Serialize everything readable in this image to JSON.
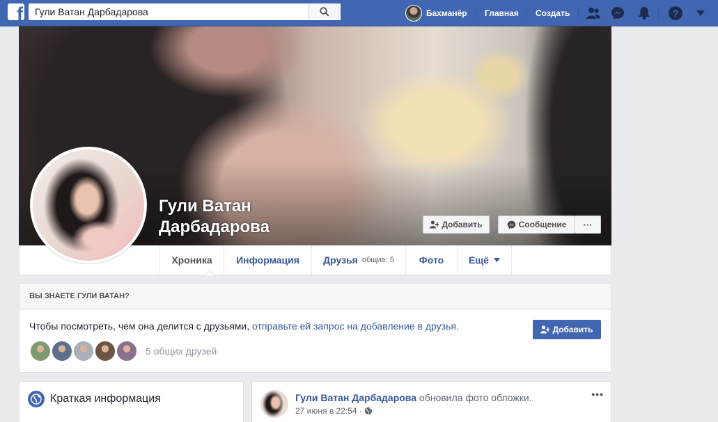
{
  "topbar": {
    "search_value": "Гули Ватан Дарбадарова",
    "user_name": "Бахманёр",
    "home": "Главная",
    "create": "Создать"
  },
  "profile": {
    "name": "Гули Ватан Дарбадарова",
    "add_friend": "Добавить",
    "message": "Сообщение",
    "more": "···"
  },
  "tabs": {
    "timeline": "Хроника",
    "about": "Информация",
    "friends": "Друзья",
    "friends_mutual": "общие: 5",
    "photos": "Фото",
    "more": "Ещё"
  },
  "know": {
    "heading": "ВЫ ЗНАЕТЕ ГУЛИ ВАТАН?",
    "text": "Чтобы посмотреть, чем она делится с друзьями, ",
    "link": "отправьте ей запрос на добавление в друзья.",
    "add_button": "Добавить",
    "mutual_friends": "5 общих друзей",
    "friend_colors": [
      "#7d9a6f",
      "#5c6f8a",
      "#a9b0b8",
      "#6b5444",
      "#8c6f8c"
    ]
  },
  "intro": {
    "title": "Краткая информация"
  },
  "post": {
    "author": "Гули Ватан Дарбадарова",
    "action": " обновила фото обложки.",
    "time": "27 июня в 22:54 · ",
    "more": "•••"
  },
  "colors": {
    "topbar": "#4267b2",
    "link": "#365899",
    "background": "#e9ebee"
  }
}
